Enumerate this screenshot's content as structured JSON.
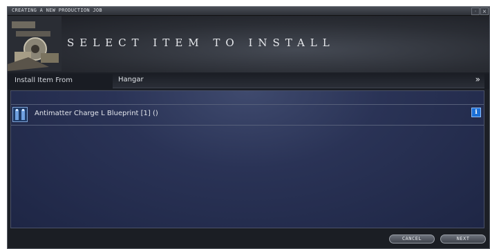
{
  "window": {
    "title": "CREATING A NEW PRODUCTION JOB",
    "header_title": "SELECT ITEM TO INSTALL"
  },
  "source": {
    "label": "Install Item From",
    "value": "Hangar",
    "icon": "double-chevron-down-icon"
  },
  "list": {
    "items": [
      {
        "label": "Antimatter Charge L Blueprint [1] ()",
        "icon": "blueprint-icon",
        "info_icon": "info-icon"
      }
    ]
  },
  "footer": {
    "cancel_label": "CANCEL",
    "next_label": "NEXT"
  }
}
